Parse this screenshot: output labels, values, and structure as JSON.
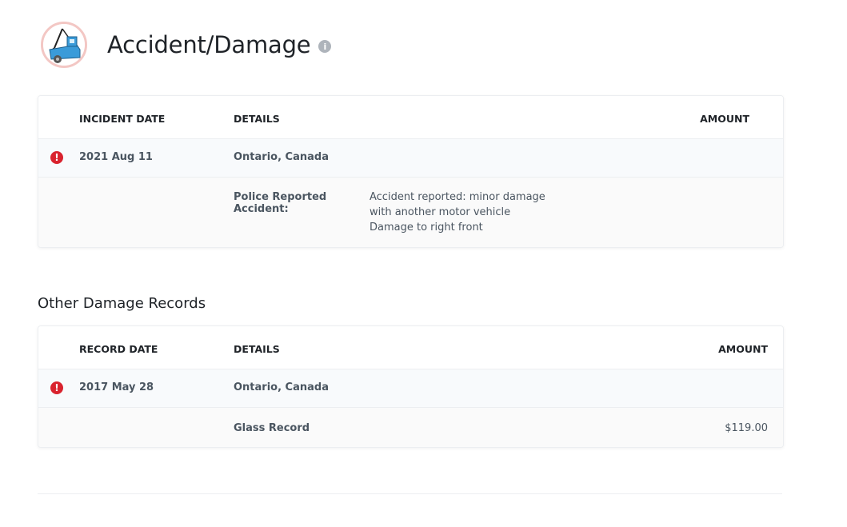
{
  "header": {
    "title": "Accident/Damage",
    "info_icon": "info-icon"
  },
  "accidents": {
    "columns": {
      "date": "INCIDENT DATE",
      "details": "DETAILS",
      "amount": "AMOUNT"
    },
    "record": {
      "date": "2021 Aug 11",
      "location": "Ontario, Canada",
      "detail_label": "Police Reported Accident:",
      "detail_lines": [
        "Accident reported: minor damage",
        "with another motor vehicle",
        "Damage to right front"
      ]
    }
  },
  "other": {
    "section_title": "Other Damage Records",
    "columns": {
      "date": "RECORD DATE",
      "details": "DETAILS",
      "amount": "AMOUNT"
    },
    "record": {
      "date": "2017 May 28",
      "location": "Ontario, Canada",
      "detail_label": "Glass Record",
      "amount": "$119.00"
    }
  },
  "colors": {
    "alert": "#d9232e",
    "tow_truck": "#3a9bd9"
  }
}
